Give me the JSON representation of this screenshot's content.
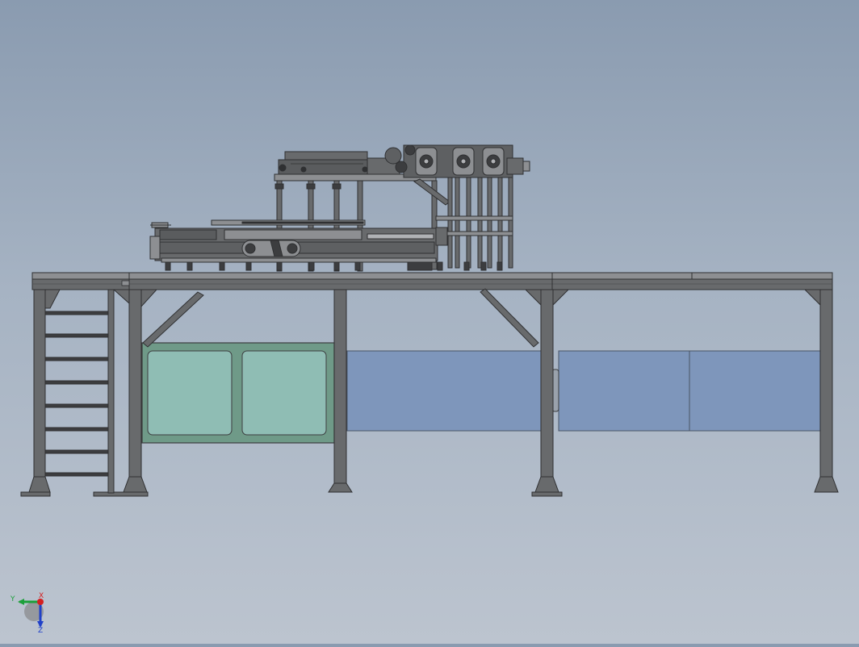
{
  "viewport": {
    "background_top": "#8a9bb0",
    "background_bottom": "#bcc4cf"
  },
  "colors": {
    "steel": "#686a6c",
    "steel_dark": "#3c3d3f",
    "steel_light": "#8d8f92",
    "green_panel": "#6f9a88",
    "green_glass": "#8fbdb4",
    "blue_panel": "#7e96bb"
  },
  "triad": {
    "x_label": "X",
    "y_label": "Y",
    "z_label": "Z",
    "x_color": "#d42020",
    "y_color": "#1ca03a",
    "z_color": "#2040c8"
  }
}
